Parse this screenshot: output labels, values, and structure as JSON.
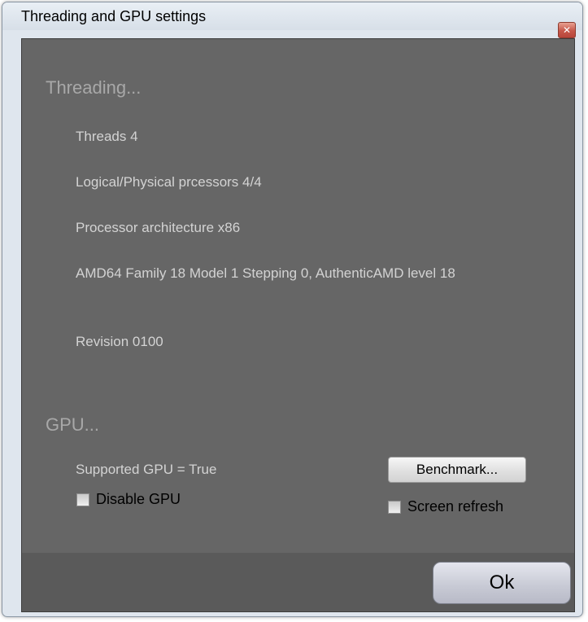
{
  "window": {
    "title": "Threading and GPU settings",
    "close_symbol": "✕"
  },
  "threading": {
    "heading": "Threading...",
    "lines": [
      "Threads 4",
      "Logical/Physical prcessors 4/4",
      "Processor architecture x86",
      "AMD64 Family 18 Model 1 Stepping 0, AuthenticAMD level 18",
      "Revision 0100"
    ]
  },
  "gpu": {
    "heading": "GPU...",
    "supported_text": "Supported GPU = True",
    "benchmark_label": "Benchmark...",
    "disable_gpu_label": "Disable GPU",
    "disable_gpu_checked": false,
    "screen_refresh_label": "Screen refresh",
    "screen_refresh_checked": false
  },
  "footer": {
    "ok_label": "Ok"
  },
  "colors": {
    "panel_bg": "#666666",
    "footer_bg": "#5a5a5a",
    "heading_text": "#a8a8a8",
    "info_text": "#d3d3d3",
    "close_button": "#c6574a"
  }
}
